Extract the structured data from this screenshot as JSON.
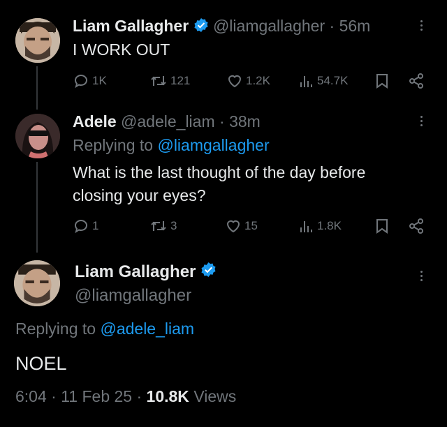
{
  "tweets": [
    {
      "name": "Liam Gallagher",
      "handle": "@liamgallagher",
      "sep": "·",
      "time": "56m",
      "text": "I WORK OUT",
      "stats": {
        "replies": "1K",
        "retweets": "121",
        "likes": "1.2K",
        "views": "54.7K"
      }
    },
    {
      "name": "Adele",
      "handle": "@adele_liam",
      "sep": "·",
      "time": "38m",
      "replying_prefix": "Replying to",
      "replying_to": "@liamgallagher",
      "text_line1": "What is the last thought of the day before",
      "text_line2": "closing your eyes?",
      "stats": {
        "replies": "1",
        "retweets": "3",
        "likes": "15",
        "views": "1.8K"
      }
    }
  ],
  "focus": {
    "name": "Liam Gallagher",
    "handle": "@liamgallagher",
    "replying_prefix": "Replying to",
    "replying_to": "@adele_liam",
    "text": "NOEL",
    "time": "6:04",
    "date": "11 Feb 25",
    "views_count": "10.8K",
    "views_label": "Views",
    "sep": "·"
  },
  "colors": {
    "background": "#000000",
    "text": "#e7e9ea",
    "muted": "#71767b",
    "link": "#1d9bf0",
    "verified": "#1d9bf0"
  },
  "icons": [
    "reply-icon",
    "retweet-icon",
    "like-icon",
    "views-icon",
    "bookmark-icon",
    "share-icon",
    "verified-badge-icon",
    "more-icon"
  ]
}
